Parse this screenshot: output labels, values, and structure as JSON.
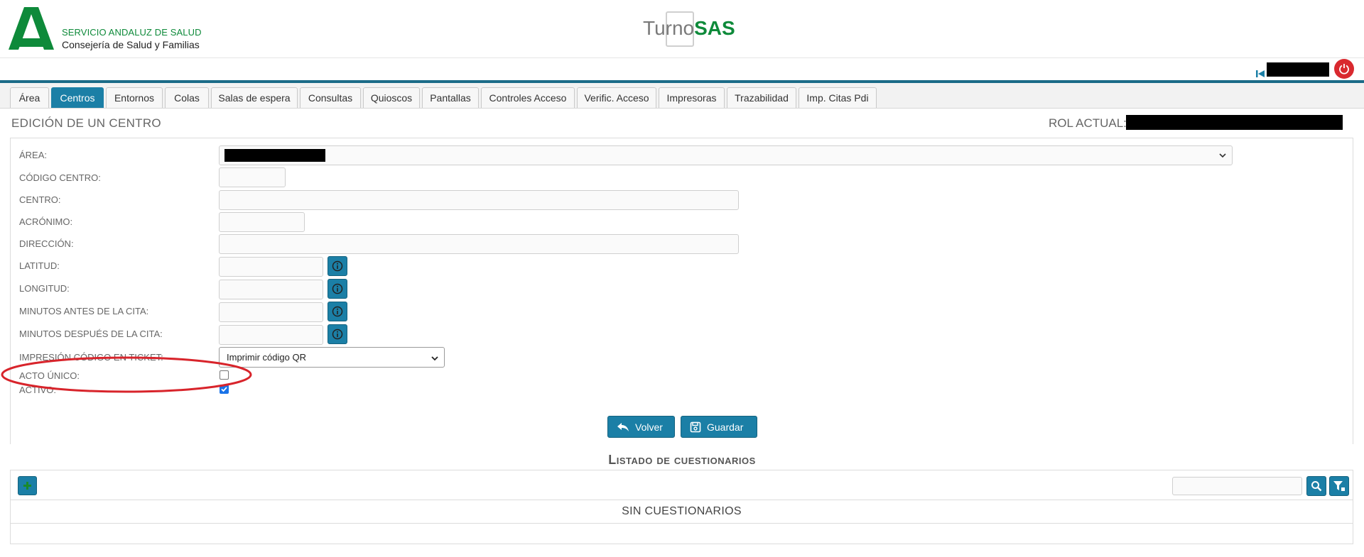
{
  "header": {
    "org_line1": "SERVICIO ANDALUZ DE SALUD",
    "org_line2": "Consejería de Salud y Familias",
    "brand_prefix": "Turno",
    "brand_suffix": "SAS",
    "colors": {
      "brand_green": "#0e8a3a",
      "accent_blue": "#1b7fa6",
      "power_red": "#d9292f"
    }
  },
  "tabs": [
    {
      "label": "Área",
      "active": false
    },
    {
      "label": "Centros",
      "active": true
    },
    {
      "label": "Entornos",
      "active": false
    },
    {
      "label": "Colas",
      "active": false
    },
    {
      "label": "Salas de espera",
      "active": false
    },
    {
      "label": "Consultas",
      "active": false
    },
    {
      "label": "Quioscos",
      "active": false
    },
    {
      "label": "Pantallas",
      "active": false
    },
    {
      "label": "Controles Acceso",
      "active": false
    },
    {
      "label": "Verific. Acceso",
      "active": false
    },
    {
      "label": "Impresoras",
      "active": false
    },
    {
      "label": "Trazabilidad",
      "active": false
    },
    {
      "label": "Imp. Citas Pdi",
      "active": false
    }
  ],
  "edit": {
    "title": "EDICIÓN DE UN CENTRO",
    "rol_label": "ROL ACTUAL:"
  },
  "form": {
    "area_label": "ÁREA:",
    "codigo_label": "CÓDIGO CENTRO:",
    "centro_label": "CENTRO:",
    "acronimo_label": "ACRÓNIMO:",
    "direccion_label": "DIRECCIÓN:",
    "latitud_label": "LATITUD:",
    "longitud_label": "LONGITUD:",
    "min_antes_label": "MINUTOS ANTES DE LA CITA:",
    "min_despues_label": "MINUTOS DESPUÉS DE LA CITA:",
    "impresion_label": "IMPRESIÓN CÓDIGO EN TICKET:",
    "impresion_value": "Imprimir código QR",
    "acto_unico_label": "ACTO ÚNICO:",
    "acto_unico_checked": false,
    "activo_label": "ACTIVO:",
    "activo_checked": true
  },
  "actions": {
    "volver": "Volver",
    "guardar": "Guardar"
  },
  "questionnaires": {
    "title": "Listado de cuestionarios",
    "empty_text": "SIN CUESTIONARIOS"
  }
}
